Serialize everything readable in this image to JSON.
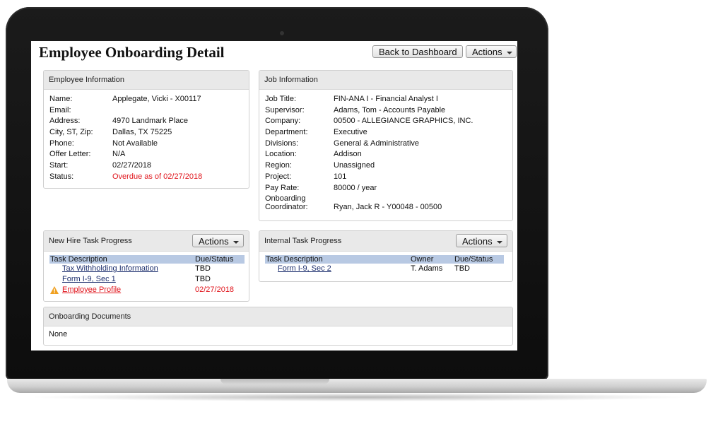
{
  "page": {
    "title": "Employee Onboarding Detail",
    "back_button": "Back to Dashboard",
    "actions_button": "Actions"
  },
  "employee_info": {
    "header": "Employee Information",
    "rows": [
      {
        "label": "Name:",
        "value": "Applegate, Vicki - X00117"
      },
      {
        "label": "Email:",
        "value": ""
      },
      {
        "label": "Address:",
        "value": "4970 Landmark Place"
      },
      {
        "label": "City, ST, Zip:",
        "value": "Dallas, TX 75225"
      },
      {
        "label": "Phone:",
        "value": "Not Available"
      },
      {
        "label": "Offer Letter:",
        "value": "N/A"
      },
      {
        "label": "Start:",
        "value": "02/27/2018"
      },
      {
        "label": "Status:",
        "value": "Overdue as of 02/27/2018"
      }
    ]
  },
  "job_info": {
    "header": "Job Information",
    "rows": [
      {
        "label": "Job Title:",
        "value": "FIN-ANA I - Financial Analyst I"
      },
      {
        "label": "Supervisor:",
        "value": "Adams, Tom - Accounts Payable"
      },
      {
        "label": "Company:",
        "value": "00500 - ALLEGIANCE GRAPHICS, INC."
      },
      {
        "label": "Department:",
        "value": "Executive"
      },
      {
        "label": "Divisions:",
        "value": "General & Administrative"
      },
      {
        "label": "Location:",
        "value": "Addison"
      },
      {
        "label": "Region:",
        "value": "Unassigned"
      },
      {
        "label": "Project:",
        "value": "101"
      },
      {
        "label": "Pay Rate:",
        "value": "80000 / year"
      }
    ],
    "coordinator_label_1": "Onboarding",
    "coordinator_label_2": "Coordinator:",
    "coordinator_value": "Ryan, Jack R - Y00048 - 00500"
  },
  "new_hire_tasks": {
    "header": "New Hire Task Progress",
    "actions": "Actions",
    "columns": [
      "Task Description",
      "Due/Status"
    ],
    "rows": [
      {
        "task": "Tax Withholding Information",
        "status": "TBD"
      },
      {
        "task": "Form I-9, Sec 1",
        "status": "TBD"
      },
      {
        "task": "Employee Profile",
        "status": "02/27/2018"
      }
    ]
  },
  "internal_tasks": {
    "header": "Internal Task Progress",
    "actions": "Actions",
    "columns": [
      "Task Description",
      "Owner",
      "Due/Status"
    ],
    "rows": [
      {
        "task": "Form I-9, Sec 2",
        "owner": "T. Adams",
        "status": "TBD"
      }
    ]
  },
  "documents": {
    "header": "Onboarding Documents",
    "content": "None"
  },
  "colors": {
    "overdue": "#e0151c",
    "link": "#1d2f6e",
    "table_header": "#b8c9e3",
    "panel_header": "#e9e9e9",
    "warning": "#f0a020"
  },
  "icons": {
    "warning": "warning-icon",
    "dropdown": "chevron-down-icon"
  }
}
